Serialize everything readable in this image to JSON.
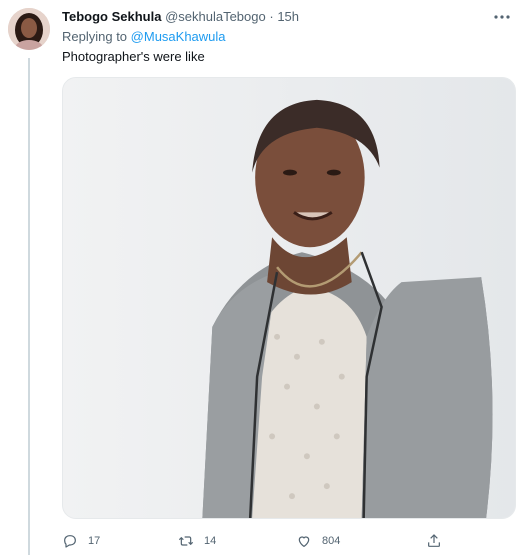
{
  "tweet": {
    "display_name": "Tebogo Sekhula",
    "handle": "@sekhulaTebogo",
    "separator": "·",
    "time": "15h",
    "replying_prefix": "Replying to",
    "replying_to": "@MusaKhawula",
    "text": "Photographer's were like"
  },
  "actions": {
    "reply_count": "17",
    "retweet_count": "14",
    "like_count": "804"
  },
  "icons": {
    "more": "more-horizontal-icon",
    "reply": "reply-icon",
    "retweet": "retweet-icon",
    "like": "heart-icon",
    "share": "share-icon"
  },
  "colors": {
    "link": "#1d9bf0",
    "secondary_text": "#536471",
    "primary_text": "#0f1419"
  }
}
